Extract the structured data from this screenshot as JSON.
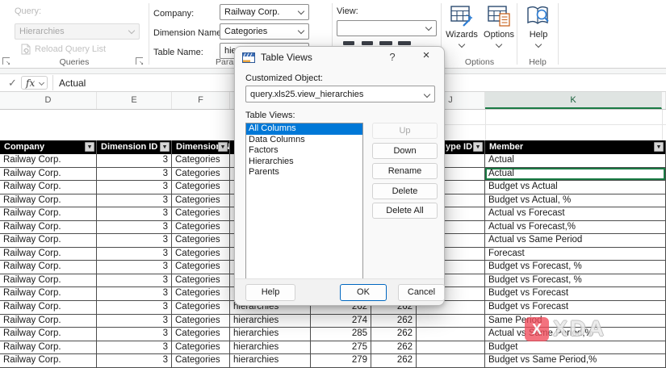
{
  "ribbon": {
    "queries": {
      "group_label": "Queries",
      "query_label": "Query:",
      "query_value": "Hierarchies",
      "reload_button_label": "Reload Query List"
    },
    "parameters": {
      "group_label": "Param",
      "company_label": "Company:",
      "company_value": "Railway Corp.",
      "dimension_name_label": "Dimension Name:",
      "dimension_name_value": "Categories",
      "table_name_label": "Table Name:",
      "table_name_value": "hier"
    },
    "view": {
      "view_label": "View:",
      "view_value": ""
    },
    "options": {
      "group_label": "Options",
      "wizards_label": "Wizards",
      "options_label": "Options"
    },
    "help": {
      "group_label": "Help",
      "help_label": "Help"
    }
  },
  "formula_bar": {
    "check_glyph": "✓",
    "fx_glyph": "fx",
    "value": "Actual"
  },
  "sheet": {
    "column_letters": {
      "d": "D",
      "e": "E",
      "f": "F",
      "j": "J",
      "k": "K"
    },
    "selected_column": "K"
  },
  "dialog": {
    "title": "Table Views",
    "help_glyph": "?",
    "close_glyph": "×",
    "customized_object_label": "Customized Object:",
    "customized_object_value": "query.xls25.view_hierarchies",
    "table_views_label": "Table Views:",
    "list_items": [
      "All Columns",
      "Data Columns",
      "Factors",
      "Hierarchies",
      "Parents"
    ],
    "selected_list_item": "All Columns",
    "buttons": {
      "up": "Up",
      "down": "Down",
      "rename": "Rename",
      "delete": "Delete",
      "delete_all": "Delete All",
      "help": "Help",
      "ok": "OK",
      "cancel": "Cancel"
    }
  },
  "table": {
    "filter_glyph": "▾",
    "selected_row_index": 1,
    "headers": {
      "company": "Company",
      "dimension_id": "Dimension ID",
      "dimension_name": "Dimension N",
      "type_id": "ype ID",
      "member": "Member"
    },
    "rows": [
      {
        "company": "Railway Corp.",
        "dimension_id": "3",
        "dimension_name": "Categories",
        "table_name": "",
        "id_1": "",
        "id_2": "",
        "member": "Actual"
      },
      {
        "company": "Railway Corp.",
        "dimension_id": "3",
        "dimension_name": "Categories",
        "table_name": "",
        "id_1": "",
        "id_2": "",
        "member": "Actual"
      },
      {
        "company": "Railway Corp.",
        "dimension_id": "3",
        "dimension_name": "Categories",
        "table_name": "",
        "id_1": "",
        "id_2": "",
        "member": "Budget vs Actual"
      },
      {
        "company": "Railway Corp.",
        "dimension_id": "3",
        "dimension_name": "Categories",
        "table_name": "",
        "id_1": "",
        "id_2": "",
        "member": "Budget vs Actual, %"
      },
      {
        "company": "Railway Corp.",
        "dimension_id": "3",
        "dimension_name": "Categories",
        "table_name": "",
        "id_1": "",
        "id_2": "",
        "member": "Actual vs Forecast"
      },
      {
        "company": "Railway Corp.",
        "dimension_id": "3",
        "dimension_name": "Categories",
        "table_name": "",
        "id_1": "",
        "id_2": "",
        "member": "Actual vs Forecast,%"
      },
      {
        "company": "Railway Corp.",
        "dimension_id": "3",
        "dimension_name": "Categories",
        "table_name": "",
        "id_1": "",
        "id_2": "",
        "member": "Actual vs Same Period"
      },
      {
        "company": "Railway Corp.",
        "dimension_id": "3",
        "dimension_name": "Categories",
        "table_name": "",
        "id_1": "",
        "id_2": "",
        "member": "Forecast"
      },
      {
        "company": "Railway Corp.",
        "dimension_id": "3",
        "dimension_name": "Categories",
        "table_name": "",
        "id_1": "",
        "id_2": "",
        "member": "Budget vs Forecast, %"
      },
      {
        "company": "Railway Corp.",
        "dimension_id": "3",
        "dimension_name": "Categories",
        "table_name": "",
        "id_1": "",
        "id_2": "",
        "member": "Budget vs Forecast, %"
      },
      {
        "company": "Railway Corp.",
        "dimension_id": "3",
        "dimension_name": "Categories",
        "table_name": "",
        "id_1": "",
        "id_2": "",
        "member": "Budget vs Forecast"
      },
      {
        "company": "Railway Corp.",
        "dimension_id": "3",
        "dimension_name": "Categories",
        "table_name": "hierarchies",
        "id_1": "262",
        "id_2": "262",
        "member": "Budget vs Forecast"
      },
      {
        "company": "Railway Corp.",
        "dimension_id": "3",
        "dimension_name": "Categories",
        "table_name": "hierarchies",
        "id_1": "274",
        "id_2": "262",
        "member": "Same Period"
      },
      {
        "company": "Railway Corp.",
        "dimension_id": "3",
        "dimension_name": "Categories",
        "table_name": "hierarchies",
        "id_1": "285",
        "id_2": "262",
        "member": "Actual vs Same Period,%"
      },
      {
        "company": "Railway Corp.",
        "dimension_id": "3",
        "dimension_name": "Categories",
        "table_name": "hierarchies",
        "id_1": "275",
        "id_2": "262",
        "member": "Budget"
      },
      {
        "company": "Railway Corp.",
        "dimension_id": "3",
        "dimension_name": "Categories",
        "table_name": "hierarchies",
        "id_1": "279",
        "id_2": "262",
        "member": "Budget vs Same Period,%"
      }
    ]
  },
  "watermark": {
    "text": "XDA",
    "badge_letter": "X"
  }
}
